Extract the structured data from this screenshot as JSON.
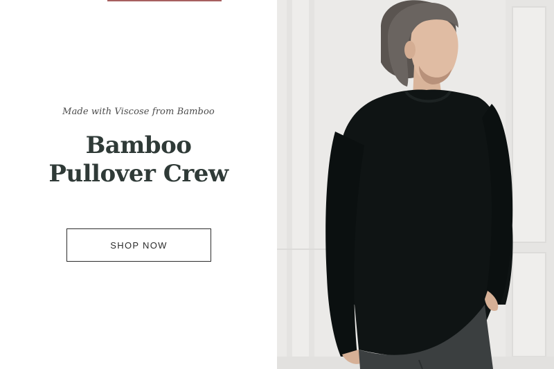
{
  "promo": {
    "eyebrow": "Made with Viscose from Bamboo",
    "title_line1": "Bamboo",
    "title_line2": "Pullover Crew",
    "cta_label": "SHOP NOW"
  },
  "colors": {
    "heading": "#2f3a37",
    "eyebrow": "#4a4a4a",
    "button_border": "#2b2b2b",
    "background": "#ffffff",
    "photo_wall": "#e9e8e6",
    "sweater": "#0f1414"
  },
  "image": {
    "subject": "man-wearing-black-pullover-photo"
  }
}
